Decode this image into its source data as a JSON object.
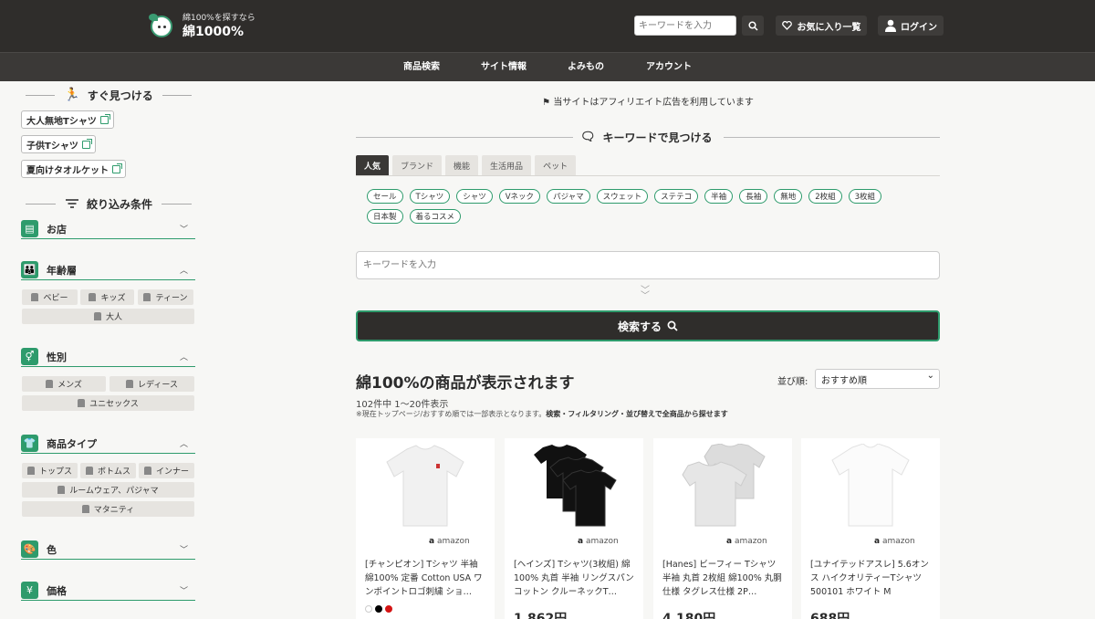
{
  "header": {
    "tagline": "綿100%を探すなら",
    "site_name": "綿1000%",
    "search_placeholder": "キーワードを入力",
    "favorites": "お気に入り一覧",
    "login": "ログイン"
  },
  "nav": [
    "商品検索",
    "サイト情報",
    "よみもの",
    "アカウント"
  ],
  "sidebar": {
    "quick_title": "すぐ見つける",
    "quick_links": [
      "大人無地Tシャツ",
      "子供Tシャツ",
      "夏向けタオルケット"
    ],
    "filter_title": "絞り込み条件",
    "filters": {
      "shop": {
        "label": "お店"
      },
      "age": {
        "label": "年齢層",
        "options": [
          "ベビー",
          "キッズ",
          "ティーン",
          "大人"
        ]
      },
      "gender": {
        "label": "性別",
        "options": [
          "メンズ",
          "レディース",
          "ユニセックス"
        ]
      },
      "type": {
        "label": "商品タイプ",
        "options": [
          "トップス",
          "ボトムス",
          "インナー",
          "ルームウェア、パジャマ",
          "マタニティ"
        ]
      },
      "color": {
        "label": "色"
      },
      "price": {
        "label": "価格"
      }
    }
  },
  "main": {
    "notice": "当サイトはアフィリエイト広告を利用しています",
    "keyword_title": "キーワードで見つける",
    "tabs": [
      "人気",
      "ブランド",
      "機能",
      "生活用品",
      "ペット"
    ],
    "tags": [
      "セール",
      "Tシャツ",
      "シャツ",
      "Vネック",
      "パジャマ",
      "スウェット",
      "ステテコ",
      "半袖",
      "長袖",
      "無地",
      "2枚組",
      "3枚組",
      "日本製",
      "着るコスメ"
    ],
    "search_placeholder": "キーワードを入力",
    "search_button": "検索する",
    "results_title": "綿100%の商品が表示されます",
    "sort_label": "並び順:",
    "sort_value": "おすすめ順",
    "count": "102件中 1〜20件表示",
    "note_prefix": "※現在トップページ/おすすめ順では一部表示となります。",
    "note_bold": "検索・フィルタリング・並び替えで全商品から探せます",
    "products": [
      {
        "store": "amazon",
        "name": "[チャンピオン] Tシャツ 半袖 綿100% 定番 Cotton USA ワンポイントロゴ刺繍 ショ…",
        "price": ""
      },
      {
        "store": "amazon",
        "name": "[ヘインズ] Tシャツ(3枚組) 綿100% 丸首 半袖 リングスパンコットン クルーネックT…",
        "price": "1,862円"
      },
      {
        "store": "amazon",
        "name": "[Hanes] ビーフィー Tシャツ 半袖 丸首 2枚組 綿100% 丸胴仕様 タグレス仕様 2P…",
        "price": "4,180円"
      },
      {
        "store": "amazon",
        "name": "[ユナイテッドアスレ] 5.6オンス ハイクオリティーTシャツ 500101 ホワイト M",
        "price": "688円"
      }
    ]
  }
}
